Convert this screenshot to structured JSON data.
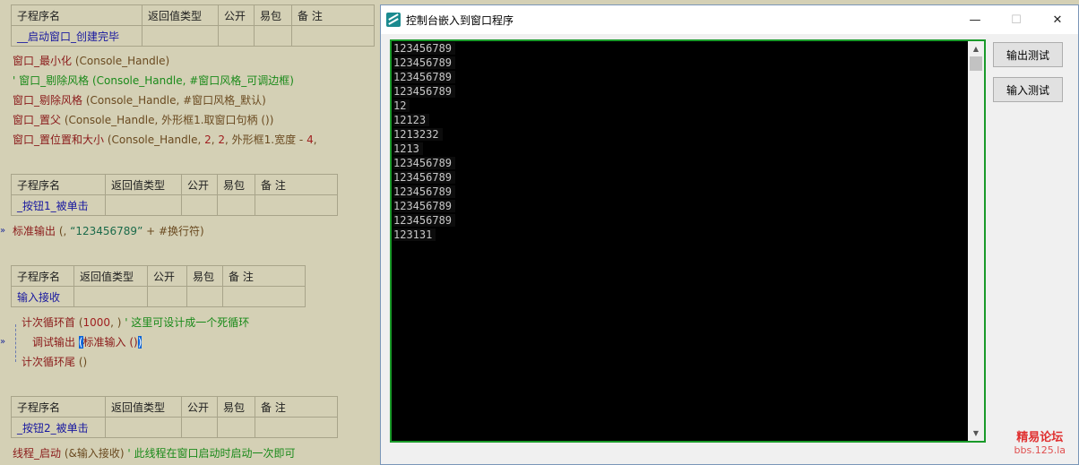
{
  "editor": {
    "table_headers_5": [
      "子程序名",
      "返回值类型",
      "公开",
      "易包",
      "备 注"
    ],
    "sub1": {
      "name": "__启动窗口_创建完毕"
    },
    "sub2": {
      "name": "_按钮1_被单击"
    },
    "sub3": {
      "name": "输入接收"
    },
    "sub4": {
      "name": "_按钮2_被单击"
    },
    "block1": {
      "l1_fn": "窗口_最小化",
      "l1_args": " (Console_Handle)",
      "l2_prefix": "' ",
      "l2_fn": "窗口_剔除风格",
      "l2_args": " (Console_Handle, #窗口风格_可调边框)",
      "l3_fn": "窗口_剔除风格",
      "l3_args": " (Console_Handle, #窗口风格_默认)",
      "l4_fn": "窗口_置父",
      "l4_args": " (Console_Handle, 外形框1.取窗口句柄 ())",
      "l5_fn": "窗口_置位置和大小",
      "l5_args_a": " (Console_Handle, ",
      "l5_n1": "2",
      "l5_sep": ", ",
      "l5_n2": "2",
      "l5_args_b": ", 外形框1.宽度  -  ",
      "l5_n3": "4",
      "l5_tail": ","
    },
    "block2": {
      "marker": "»",
      "fn": "标准输出",
      "args_a": " (, ",
      "str": "“123456789”",
      "args_b": "  +  #换行符)"
    },
    "block3": {
      "loop_head_fn": "计次循环首",
      "loop_head_args_a": " (",
      "loop_head_num": "1000",
      "loop_head_args_b": ", )  ",
      "loop_head_comment": "' 这里可设计成一个死循环",
      "marker": "»",
      "debug_fn": "调试输出 ",
      "debug_sel_a": "(",
      "debug_inner": "标准输入 ()",
      "debug_sel_b": ")",
      "loop_tail_fn": "计次循环尾",
      "loop_tail_args": " ()"
    },
    "block4": {
      "fn": "线程_启动",
      "args": " (&输入接收)  ",
      "comment": "' 此线程在窗口启动时启动一次即可"
    }
  },
  "window": {
    "title": "控制台嵌入到窗口程序",
    "minimize": "—",
    "maximize": "☐",
    "close": "✕",
    "console_lines": [
      "123456789",
      "123456789",
      "123456789",
      "123456789",
      "12",
      "12123",
      "1213232",
      "1213",
      "123456789",
      "123456789",
      "123456789",
      "123456789",
      "123456789",
      "123131"
    ],
    "scroll_up": "▲",
    "scroll_down": "▼",
    "btn_output": "输出测试",
    "btn_input": "输入测试"
  },
  "watermark": {
    "line1": "精易论坛",
    "line2": "bbs.125.la"
  },
  "colors": {
    "console_border": "#1a9a2a",
    "editor_bg": "#d4d0b5",
    "selection": "#0a64d8"
  }
}
